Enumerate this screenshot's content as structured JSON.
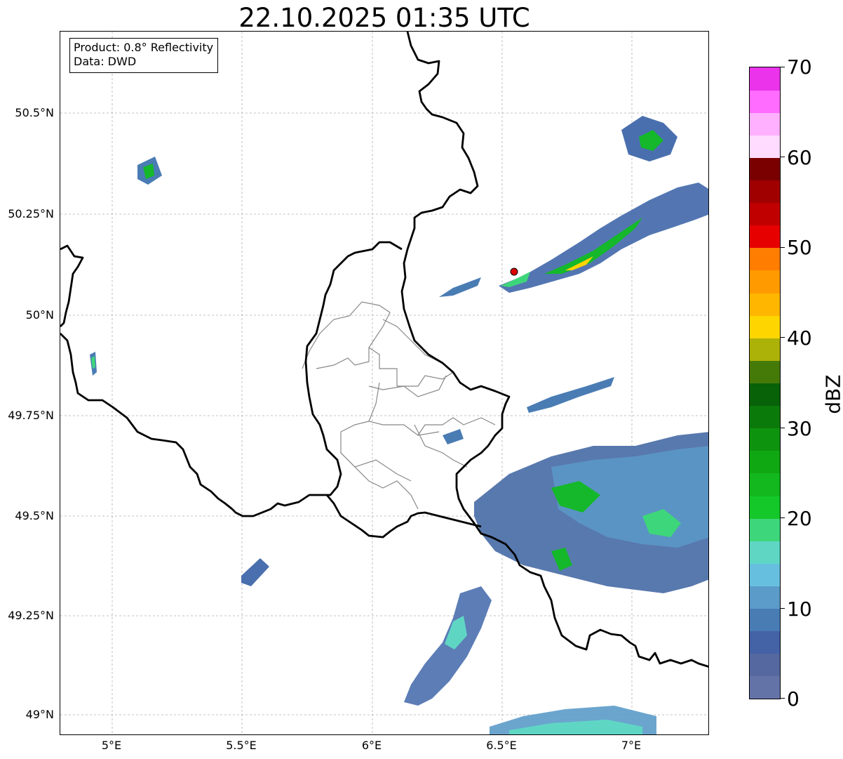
{
  "title": "22.10.2025 01:35 UTC",
  "info": {
    "product": "Product: 0.8° Reflectivity",
    "source": "Data: DWD"
  },
  "axes": {
    "lat_labels": [
      "50.5°N",
      "50.25°N",
      "50°N",
      "49.75°N",
      "49.5°N",
      "49.25°N",
      "49°N"
    ],
    "lat_values": [
      50.5,
      50.25,
      50.0,
      49.75,
      49.5,
      49.25,
      49.0
    ],
    "lon_labels": [
      "5°E",
      "5.5°E",
      "6°E",
      "6.5°E",
      "7°E"
    ],
    "lon_values": [
      5.0,
      5.5,
      6.0,
      6.5,
      7.0
    ],
    "lon_range": [
      4.8,
      7.3
    ],
    "lat_range": [
      48.95,
      50.7
    ]
  },
  "colorbar": {
    "label": "dBZ",
    "ticks": [
      "0",
      "10",
      "20",
      "30",
      "40",
      "50",
      "60",
      "70"
    ],
    "tick_values": [
      0,
      10,
      20,
      30,
      40,
      50,
      60,
      70
    ],
    "range": [
      0,
      70
    ],
    "step": 2.5,
    "colors": [
      "#6473a7",
      "#5568a0",
      "#4462a6",
      "#4a7cb4",
      "#5b9bc9",
      "#67bfdf",
      "#5fd6c4",
      "#3ed67a",
      "#14c82a",
      "#12b81d",
      "#10a812",
      "#0e930e",
      "#0a7a0a",
      "#086208",
      "#467a08",
      "#adb208",
      "#ffd500",
      "#ffb600",
      "#ff9a00",
      "#ff7d00",
      "#e60000",
      "#c00000",
      "#a00000",
      "#7a0000",
      "#ffdbff",
      "#ffb0ff",
      "#ff6cff",
      "#ea33ea"
    ]
  },
  "radar_site": {
    "lon": 6.55,
    "lat": 50.11,
    "color": "#dd0000"
  }
}
